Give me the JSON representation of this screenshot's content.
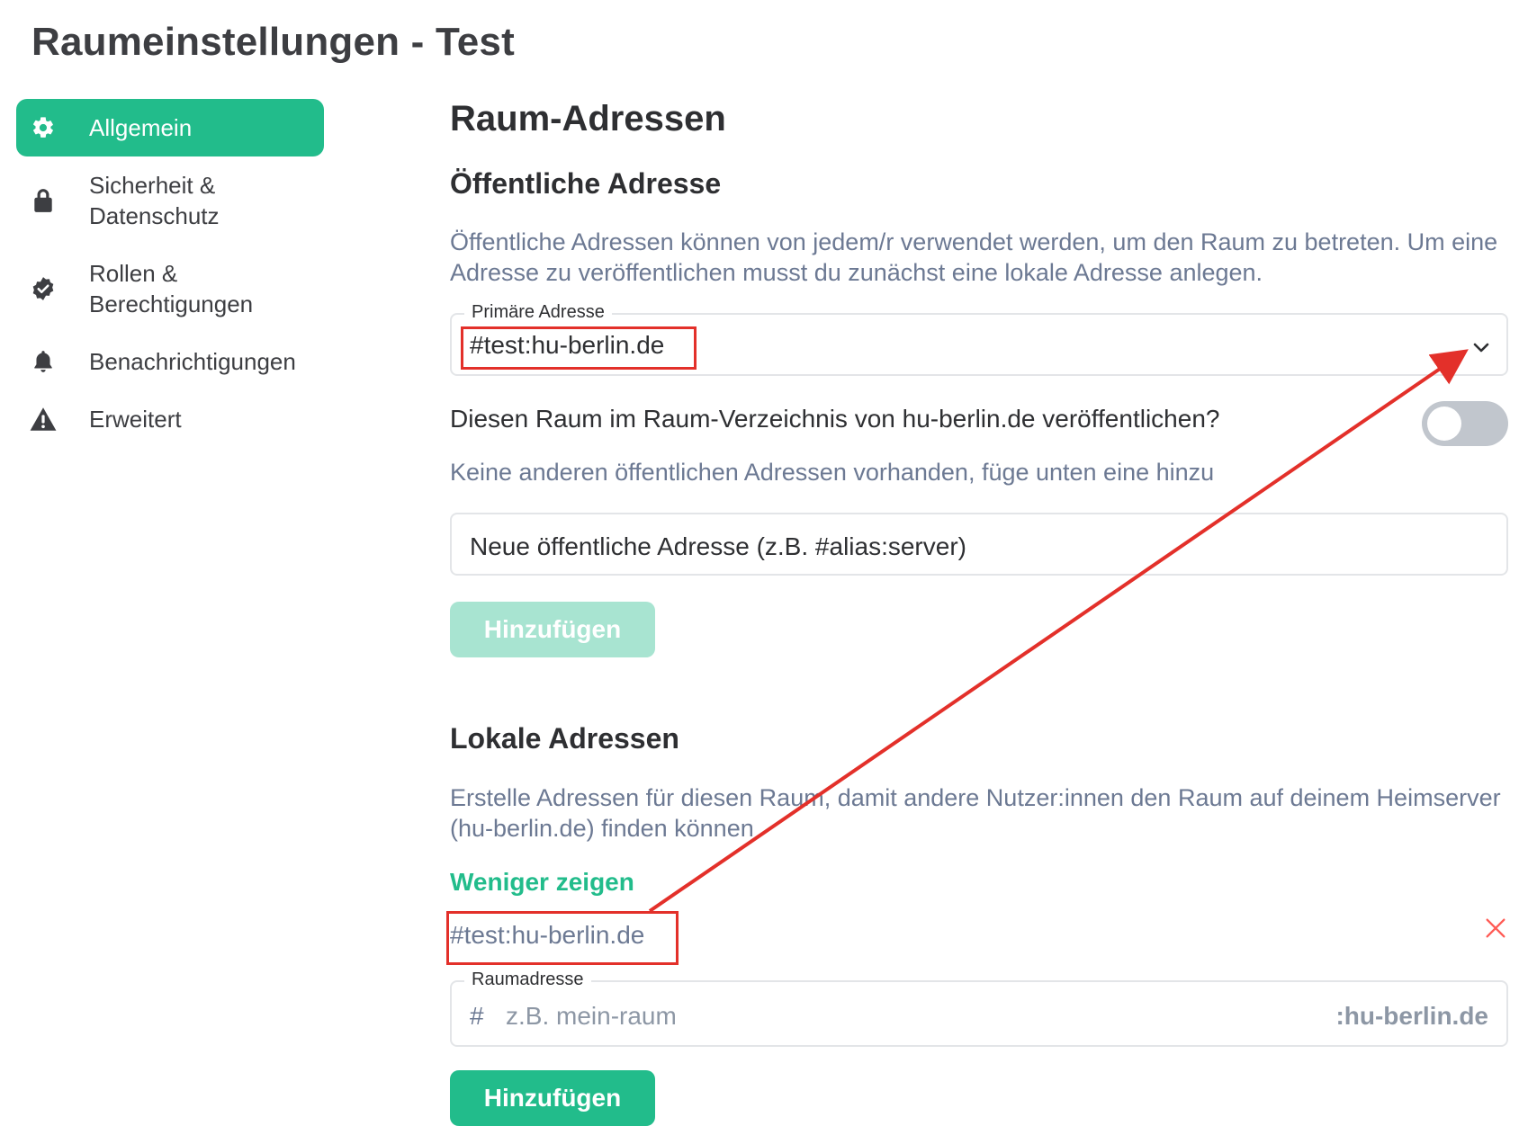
{
  "page": {
    "title": "Raumeinstellungen - Test"
  },
  "sidebar": {
    "items": [
      {
        "label": "Allgemein",
        "icon": "gear-icon",
        "active": true
      },
      {
        "label": "Sicherheit &\nDatenschutz",
        "icon": "lock-icon",
        "active": false
      },
      {
        "label": "Rollen &\nBerechtigungen",
        "icon": "badge-check-icon",
        "active": false
      },
      {
        "label": "Benachrichtigungen",
        "icon": "bell-icon",
        "active": false
      },
      {
        "label": "Erweitert",
        "icon": "warning-icon",
        "active": false
      }
    ]
  },
  "main": {
    "heading": "Raum-Adressen",
    "public": {
      "heading": "Öffentliche Adresse",
      "description": "Öffentliche Adressen können von jedem/r verwendet werden, um den Raum zu betreten. Um eine Adresse zu veröffentlichen musst du zunächst eine lokale Adresse anlegen.",
      "primary_label": "Primäre Adresse",
      "primary_value": "#test:hu-berlin.de",
      "publish_label": "Diesen Raum im Raum-Verzeichnis von hu-berlin.de veröffentlichen?",
      "publish_enabled": false,
      "no_other_note": "Keine anderen öffentlichen Adressen vorhanden, füge unten eine hinzu",
      "new_address_placeholder": "Neue öffentliche Adresse (z.B. #alias:server)",
      "add_button": "Hinzufügen"
    },
    "local": {
      "heading": "Lokale Adressen",
      "description": "Erstelle Adressen für diesen Raum, damit andere Nutzer:innen den Raum auf deinem Heimserver (hu-berlin.de) finden können",
      "show_less": "Weniger zeigen",
      "alias": "#test:hu-berlin.de",
      "room_address_label": "Raumadresse",
      "hash_prefix": "#",
      "placeholder": "z.B. mein-raum",
      "server_suffix": ":hu-berlin.de",
      "add_button": "Hinzufügen"
    }
  },
  "colors": {
    "accent": "#22bc8b",
    "accent_disabled": "#a8e4d1",
    "muted_text": "#6c7993",
    "annotation_red": "#e3302a",
    "toggle_off": "#c1c6cd"
  }
}
